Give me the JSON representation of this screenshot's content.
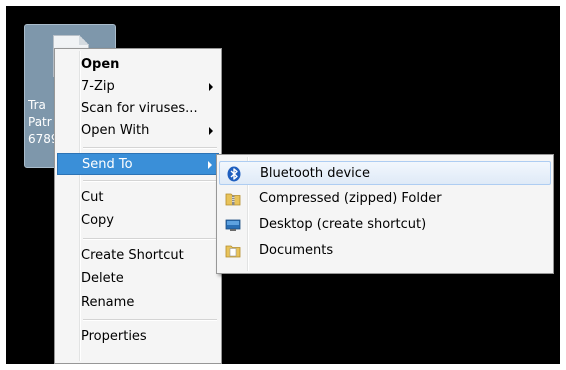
{
  "desktop_icon": {
    "caption_lines": [
      "Tra",
      "Patr",
      "6789"
    ]
  },
  "context_menu": {
    "items": [
      {
        "label": "Open"
      },
      {
        "label": "7-Zip"
      },
      {
        "label": "Scan for viruses..."
      },
      {
        "label": "Open With"
      },
      {
        "label": "Send To"
      },
      {
        "label": "Cut"
      },
      {
        "label": "Copy"
      },
      {
        "label": "Create Shortcut"
      },
      {
        "label": "Delete"
      },
      {
        "label": "Rename"
      },
      {
        "label": "Properties"
      }
    ],
    "active_item": "Send To"
  },
  "send_to_menu": {
    "items": [
      {
        "label": "Bluetooth device",
        "icon": "bluetooth-icon"
      },
      {
        "label": "Compressed (zipped) Folder",
        "icon": "zip-folder-icon"
      },
      {
        "label": "Desktop (create shortcut)",
        "icon": "desktop-icon"
      },
      {
        "label": "Documents",
        "icon": "documents-folder-icon"
      }
    ],
    "hovered_item": "Bluetooth device"
  },
  "colors": {
    "desktop_background": "#000000",
    "selection_blue": "#3a8fd8",
    "icon_selection": "#7e97ab"
  }
}
